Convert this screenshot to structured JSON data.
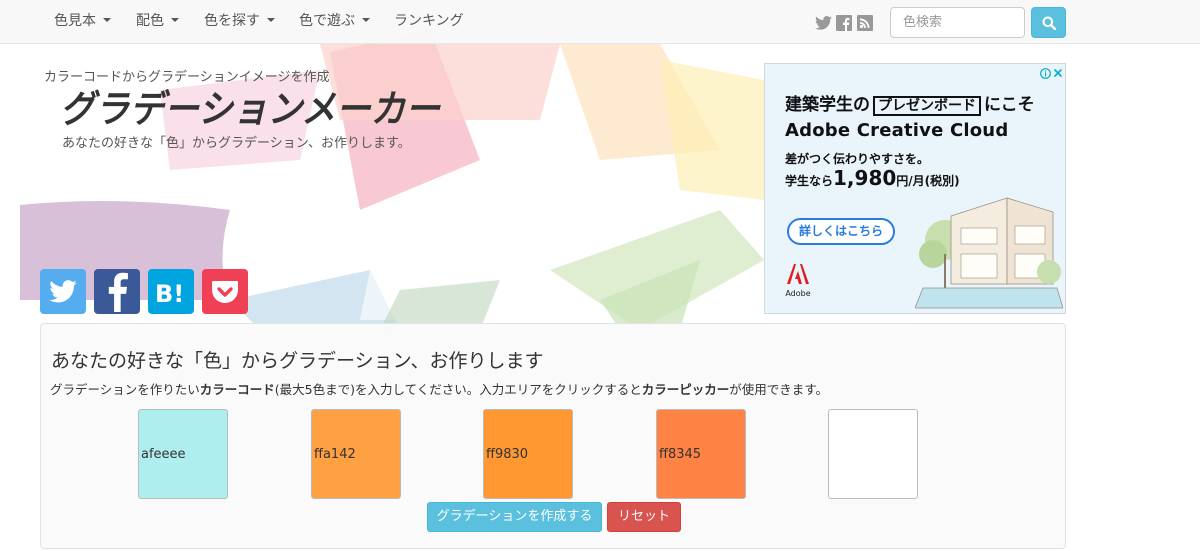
{
  "nav": {
    "items": [
      {
        "label": "色見本",
        "dropdown": true
      },
      {
        "label": "配色",
        "dropdown": true
      },
      {
        "label": "色を探す",
        "dropdown": true
      },
      {
        "label": "色で遊ぶ",
        "dropdown": true
      },
      {
        "label": "ランキング",
        "dropdown": false
      }
    ],
    "social": [
      "twitter-icon",
      "facebook-icon",
      "rss-icon"
    ],
    "search_placeholder": "色検索",
    "search_icon": "search-icon"
  },
  "header": {
    "tagline": "カラーコードからグラデーションイメージを作成",
    "logo_text": "グラデーションメーカー",
    "subtitle": "あなたの好きな「色」からグラデーション、お作りします。"
  },
  "share_buttons": [
    {
      "name": "twitter",
      "color": "#55acee"
    },
    {
      "name": "facebook",
      "color": "#3b5998"
    },
    {
      "name": "hatena-bookmark",
      "color": "#00a4de"
    },
    {
      "name": "pocket",
      "color": "#ef4056"
    }
  ],
  "ad": {
    "line1_pre": "建築学生の",
    "line1_box": "プレゼンボード",
    "line1_post": "にこそ",
    "line2": "Adobe Creative Cloud",
    "line3": "差がつく伝わりやすさを。",
    "line4_pre": "学生なら",
    "line4_price": "1,980",
    "line4_post": "円/月(税別)",
    "cta": "詳しくはこちら",
    "brand": "Adobe"
  },
  "panel": {
    "title": "あなたの好きな「色」からグラデーション、お作りします",
    "desc_1": "グラデーションを作りたい",
    "desc_2": "カラーコード",
    "desc_3": "(最大5色まで)を入力してください。入力エリアをクリックすると",
    "desc_4": "カラーピッカー",
    "desc_5": "が使用できます。",
    "swatches": [
      {
        "value": "afeeee",
        "color": "#afeeee"
      },
      {
        "value": "ffa142",
        "color": "#ffa142"
      },
      {
        "value": "ff9830",
        "color": "#ff9830"
      },
      {
        "value": "ff8345",
        "color": "#ff8345"
      },
      {
        "value": "",
        "color": "#ffffff"
      }
    ],
    "create_label": "グラデーションを作成する",
    "reset_label": "リセット"
  }
}
